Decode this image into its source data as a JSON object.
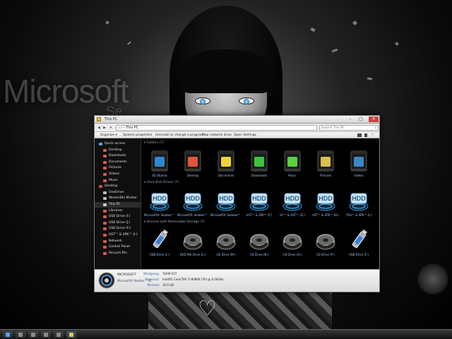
{
  "wallpaper": {
    "brand_text": "Microsoft",
    "sub_text": "Se"
  },
  "window": {
    "title": "This PC",
    "address": "This PC",
    "search_placeholder": "Search This PC"
  },
  "toolbar": {
    "items": [
      "Organize ▾",
      "System properties",
      "Uninstall or change a program",
      "Map network drive",
      "Open Settings"
    ]
  },
  "nav": {
    "items": [
      {
        "label": "Quick access",
        "icon": "star-icon",
        "color": "#4aa3ff"
      },
      {
        "label": "Desktop",
        "icon": "folder-icon",
        "color": "#d95a4a"
      },
      {
        "label": "Downloads",
        "icon": "folder-icon",
        "color": "#d95a4a"
      },
      {
        "label": "Documents",
        "icon": "folder-icon",
        "color": "#d95a4a"
      },
      {
        "label": "Pictures",
        "icon": "folder-icon",
        "color": "#d95a4a"
      },
      {
        "label": "Videos",
        "icon": "folder-icon",
        "color": "#d95a4a"
      },
      {
        "label": "Music",
        "icon": "folder-icon",
        "color": "#d95a4a"
      },
      {
        "label": "Desktop",
        "icon": "desktop-icon",
        "color": "#c94a4a"
      },
      {
        "label": "OneDrive",
        "icon": "cloud-icon",
        "color": "#bbbbbb"
      },
      {
        "label": "WorkerBhi Muster",
        "icon": "user-icon",
        "color": "#bbbbbb"
      },
      {
        "label": "This PC",
        "icon": "computer-icon",
        "color": "#cccccc",
        "selected": true
      },
      {
        "label": "Libraries",
        "icon": "library-icon",
        "color": "#d95a4a"
      },
      {
        "label": "USB Drive (I:)",
        "icon": "usb-icon",
        "color": "#d95a4a"
      },
      {
        "label": "USB Drive (J:)",
        "icon": "usb-icon",
        "color": "#d95a4a"
      },
      {
        "label": "USB Drive (F:)",
        "icon": "usb-icon",
        "color": "#d95a4a"
      },
      {
        "label": "UST™ & SPK™ (I:)",
        "icon": "drive-icon",
        "color": "#d95a4a"
      },
      {
        "label": "Network",
        "icon": "network-icon",
        "color": "#d95a4a"
      },
      {
        "label": "Control Panel",
        "icon": "control-panel-icon",
        "color": "#d95a4a"
      },
      {
        "label": "Recycle Bin",
        "icon": "recycle-bin-icon",
        "color": "#d95a4a"
      }
    ]
  },
  "groups": {
    "folders_header": "Folders (7)",
    "drives_header": "Hard Disk Drives (7)",
    "removable_header": "Devices with Removable Storage (7)"
  },
  "folders": [
    {
      "label": "3D Objects",
      "color": "#2e86d6"
    },
    {
      "label": "Desktop",
      "color": "#e0563a"
    },
    {
      "label": "Documents",
      "color": "#f3d23a"
    },
    {
      "label": "Downloads",
      "color": "#3ec43e"
    },
    {
      "label": "Music",
      "color": "#5ad23e"
    },
    {
      "label": "Pictures",
      "color": "#d9c04a"
    },
    {
      "label": "Videos",
      "color": "#3a88c8"
    }
  ],
  "drives": [
    {
      "label": "Microsoft® Seadeo™ (C:)"
    },
    {
      "label": "Microsoft® Seadeo™ (D:)"
    },
    {
      "label": "Microsoft® Seadeo™ (E:)"
    },
    {
      "label": "UST™ & SPK™ (F:)"
    },
    {
      "label": "VC™ & UST™ (G:)"
    },
    {
      "label": "UST™ & SPK™ (H:)"
    },
    {
      "label": "TOS™ & SPK™ (I:)"
    }
  ],
  "removables": [
    {
      "label": "USB Drive (L:)",
      "kind": "usb"
    },
    {
      "label": "DVD RW Drive (L:)",
      "kind": "disc"
    },
    {
      "label": "CD Drive (M:)",
      "kind": "disc"
    },
    {
      "label": "CD Drive (N:)",
      "kind": "disc"
    },
    {
      "label": "CD Drive (O:)",
      "kind": "disc"
    },
    {
      "label": "CD Drive (P:)",
      "kind": "disc"
    },
    {
      "label": "USB Drive (F:)",
      "kind": "usb"
    }
  ],
  "details": {
    "name": "MICROSOFT",
    "model": "Microsoft® Seadeo™ PC",
    "workgroup_label": "Workgroup:",
    "workgroup": "TEAM UST",
    "processor_label": "Processor:",
    "processor": "Intel(R) Core(TM) i7-8086K CPU @ 4.00GHz",
    "memory_label": "Memory:",
    "memory": "16.0 GB"
  },
  "colors": {
    "accent": "#4aa3ff",
    "label_blue": "#9cc8ff"
  }
}
